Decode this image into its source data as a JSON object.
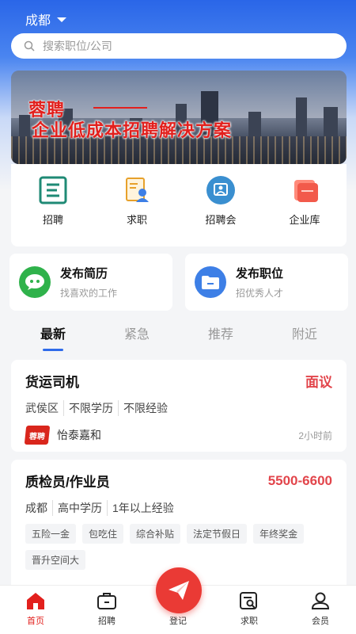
{
  "header": {
    "city": "成都"
  },
  "search": {
    "placeholder": "搜索职位/公司"
  },
  "banner": {
    "line1": "蓉聘",
    "line2": "企业低成本招聘解决方案"
  },
  "quick_entries": [
    {
      "label": "招聘",
      "icon": "recruit-icon"
    },
    {
      "label": "求职",
      "icon": "resume-icon"
    },
    {
      "label": "招聘会",
      "icon": "job-fair-icon"
    },
    {
      "label": "企业库",
      "icon": "company-library-icon"
    }
  ],
  "publish": {
    "resume": {
      "title": "发布简历",
      "subtitle": "找喜欢的工作"
    },
    "job": {
      "title": "发布职位",
      "subtitle": "招优秀人才"
    }
  },
  "tabs": [
    "最新",
    "紧急",
    "推荐",
    "附近"
  ],
  "jobs": [
    {
      "title": "货运司机",
      "salary": "面议",
      "requirements": [
        "武侯区",
        "不限学历",
        "不限经验"
      ],
      "company": "怡泰嘉和",
      "company_logo_text": "蓉聘",
      "time": "2小时前"
    },
    {
      "title": "质检员/作业员",
      "salary": "5500-6600",
      "requirements": [
        "成都",
        "高中学历",
        "1年以上经验"
      ],
      "tags": [
        "五险一金",
        "包吃住",
        "综合补贴",
        "法定节假日",
        "年终奖金",
        "晋升空间大"
      ]
    }
  ],
  "tabbar": [
    {
      "label": "首页",
      "icon": "home-icon"
    },
    {
      "label": "招聘",
      "icon": "briefcase-icon"
    },
    {
      "label": "登记",
      "icon": "paper-plane-icon"
    },
    {
      "label": "求职",
      "icon": "search-resume-icon"
    },
    {
      "label": "会员",
      "icon": "user-icon"
    }
  ],
  "colors": {
    "primary": "#2f6bea",
    "accent": "#e2454b"
  }
}
